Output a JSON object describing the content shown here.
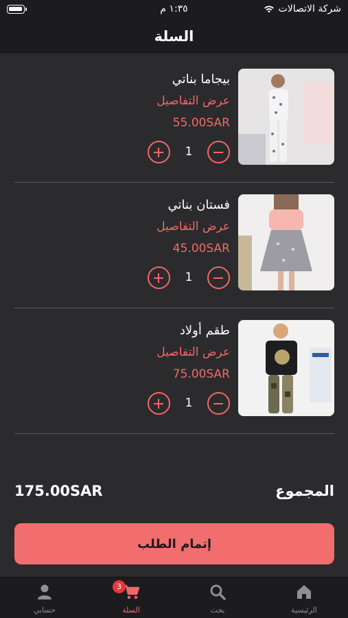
{
  "status_bar": {
    "carrier": "شركة الاتصالات",
    "time": "١:٣٥ م"
  },
  "nav": {
    "title": "السلة"
  },
  "cart": {
    "items": [
      {
        "name": "بيجاما بناتي",
        "details_link": "عرض التفاصيل",
        "price": "55.00SAR",
        "quantity": "1"
      },
      {
        "name": "فستان بناتي",
        "details_link": "عرض التفاصيل",
        "price": "45.00SAR",
        "quantity": "1"
      },
      {
        "name": "طقم أولاد",
        "details_link": "عرض التفاصيل",
        "price": "75.00SAR",
        "quantity": "1"
      }
    ]
  },
  "summary": {
    "total_label": "المجموع",
    "total_value": "175.00SAR"
  },
  "checkout": {
    "label": "إتمام الطلب"
  },
  "tab_bar": {
    "tabs": [
      {
        "label": "الرئيسية",
        "icon": "home-icon"
      },
      {
        "label": "بحث",
        "icon": "search-icon"
      },
      {
        "label": "السلة",
        "icon": "cart-icon",
        "badge": "3",
        "active": true
      },
      {
        "label": "حسابي",
        "icon": "person-icon"
      }
    ]
  },
  "colors": {
    "accent": "#f26868",
    "background": "#2b2b2d",
    "bar_background": "#1c1c1e",
    "badge": "#e5383b"
  }
}
